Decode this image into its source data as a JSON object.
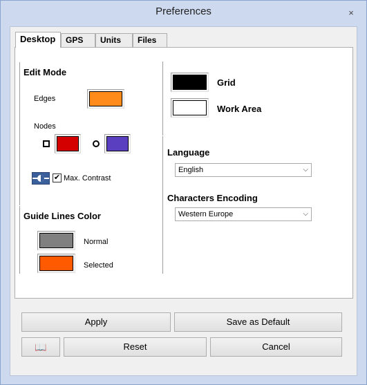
{
  "window": {
    "title": "Preferences",
    "close_glyph": "×"
  },
  "tabs": [
    {
      "label": "Desktop",
      "active": true
    },
    {
      "label": "GPS",
      "active": false
    },
    {
      "label": "Units",
      "active": false
    },
    {
      "label": "Files",
      "active": false
    }
  ],
  "edit_mode": {
    "title": "Edit Mode",
    "edges_label": "Edges",
    "edges_color": "#ff8c1a",
    "nodes_label": "Nodes",
    "node_square_color": "#d40000",
    "node_circle_color": "#5a3fc0",
    "max_contrast_label": "Max. Contrast",
    "max_contrast_checked": "✔"
  },
  "guide_lines": {
    "title": "Guide Lines Color",
    "normal_label": "Normal",
    "normal_color": "#808080",
    "selected_label": "Selected",
    "selected_color": "#ff5a00"
  },
  "display": {
    "grid_label": "Grid",
    "grid_color": "#000000",
    "work_area_label": "Work Area",
    "work_area_color": "#ffffff"
  },
  "language": {
    "title": "Language",
    "selected": "English"
  },
  "encoding": {
    "title": "Characters Encoding",
    "selected": "Western Europe"
  },
  "buttons": {
    "apply": "Apply",
    "save_default": "Save as Default",
    "reset": "Reset",
    "cancel": "Cancel"
  },
  "icons": {
    "close": "close-icon",
    "book": "book-icon",
    "contrast": "contrast-icon",
    "dropdown": "chevron-down-icon"
  }
}
